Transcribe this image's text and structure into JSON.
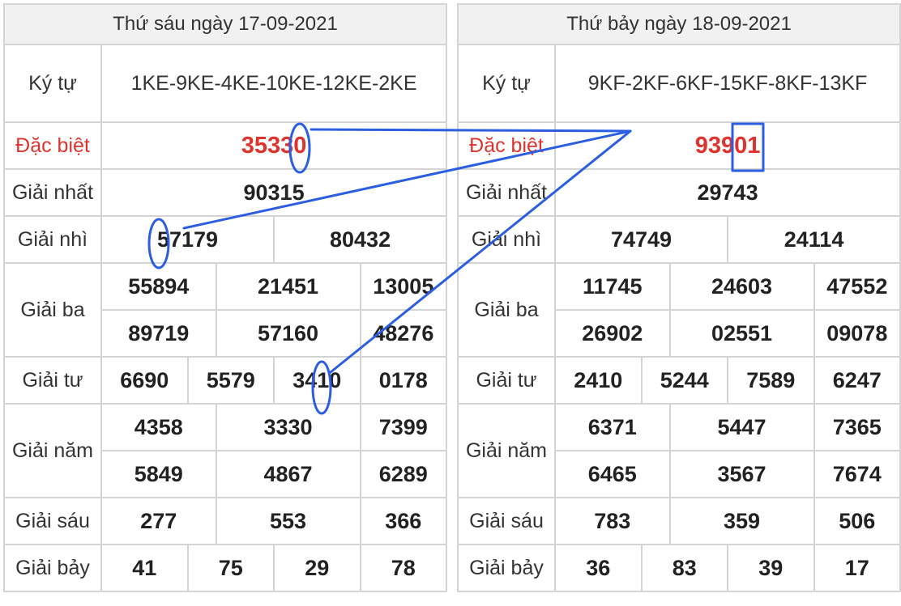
{
  "tables": [
    {
      "date": "Thứ sáu ngày 17-09-2021",
      "ky_tu": "1KE-9KE-4KE-10KE-12KE-2KE",
      "dac_biet": "35330",
      "giai_nhat": "90315",
      "giai_nhi": [
        "57179",
        "80432"
      ],
      "giai_ba": [
        "55894",
        "21451",
        "13005",
        "89719",
        "57160",
        "48276"
      ],
      "giai_tu": [
        "6690",
        "5579",
        "3410",
        "0178"
      ],
      "giai_nam": [
        "4358",
        "3330",
        "7399",
        "5849",
        "4867",
        "6289"
      ],
      "giai_sau": [
        "277",
        "553",
        "366"
      ],
      "giai_bay": [
        "41",
        "75",
        "29",
        "78"
      ]
    },
    {
      "date": "Thứ bảy ngày 18-09-2021",
      "ky_tu": "9KF-2KF-6KF-15KF-8KF-13KF",
      "dac_biet": "93901",
      "giai_nhat": "29743",
      "giai_nhi": [
        "74749",
        "24114"
      ],
      "giai_ba": [
        "11745",
        "24603",
        "47552",
        "26902",
        "02551",
        "09078"
      ],
      "giai_tu": [
        "2410",
        "5244",
        "7589",
        "6247"
      ],
      "giai_nam": [
        "6371",
        "5447",
        "7365",
        "6465",
        "3567",
        "7674"
      ],
      "giai_sau": [
        "783",
        "359",
        "506"
      ],
      "giai_bay": [
        "36",
        "83",
        "39",
        "17"
      ]
    }
  ],
  "labels": {
    "ky_tu": "Ký tự",
    "dac_biet": "Đặc biệt",
    "giai_nhat": "Giải nhất",
    "giai_nhi": "Giải nhì",
    "giai_ba": "Giải ba",
    "giai_tu": "Giải tư",
    "giai_nam": "Giải năm",
    "giai_sau": "Giải sáu",
    "giai_bay": "Giải bảy"
  },
  "colors": {
    "special": "#e0332d",
    "annotation": "#2b5ee0",
    "border": "#d4d4d4",
    "header_bg": "#f1f1f1"
  }
}
